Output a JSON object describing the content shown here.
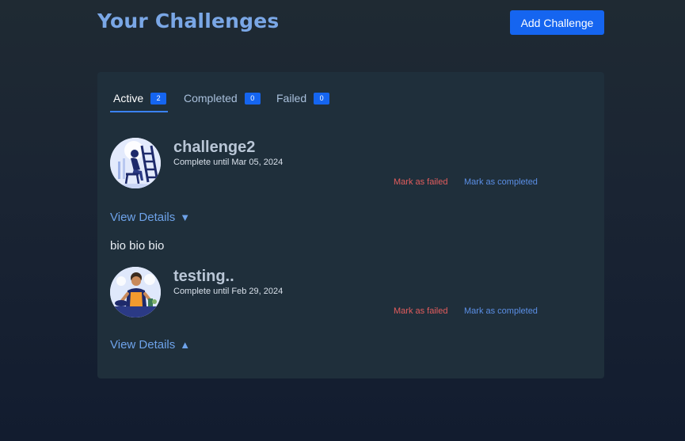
{
  "header": {
    "title": "Your Challenges",
    "add_button_label": "Add Challenge"
  },
  "tabs": [
    {
      "label": "Active",
      "count": "2",
      "active": true
    },
    {
      "label": "Completed",
      "count": "0",
      "active": false
    },
    {
      "label": "Failed",
      "count": "0",
      "active": false
    }
  ],
  "challenges": [
    {
      "title": "challenge2",
      "until": "Complete until Mar 05, 2024",
      "mark_failed": "Mark as failed",
      "mark_completed": "Mark as completed",
      "view_details": "View Details",
      "arrow": "▼",
      "expanded": false,
      "bio": "bio bio bio"
    },
    {
      "title": "testing..",
      "until": "Complete until Feb 29, 2024",
      "mark_failed": "Mark as failed",
      "mark_completed": "Mark as completed",
      "view_details": "View Details",
      "arrow": "▲",
      "expanded": true
    }
  ],
  "colors": {
    "accent": "#1565f0",
    "title": "#7aa7e6",
    "failed": "#e35d5d",
    "completed": "#5b8fe6",
    "panel": "#1f2f3b"
  }
}
